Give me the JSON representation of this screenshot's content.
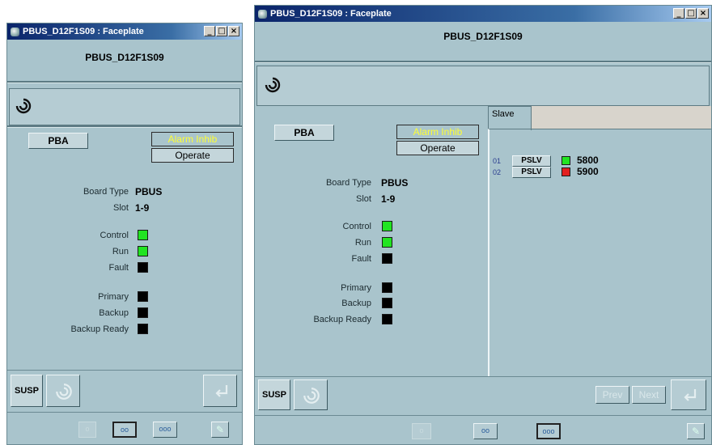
{
  "left": {
    "title": "PBUS_D12F1S09 : Faceplate",
    "header": "PBUS_D12F1S09",
    "pba_label": "PBA",
    "alarm_label": "Alarm Inhib",
    "operate_label": "Operate",
    "board_type_label": "Board Type",
    "board_type_value": "PBUS",
    "slot_label": "Slot",
    "slot_value": "1-9",
    "control_label": "Control",
    "run_label": "Run",
    "fault_label": "Fault",
    "primary_label": "Primary",
    "backup_label": "Backup",
    "backup_ready_label": "Backup Ready",
    "susp_label": "SUSP",
    "page1": "o",
    "page2": "oo",
    "page3": "ooo"
  },
  "right": {
    "title": "PBUS_D12F1S09 : Faceplate",
    "header": "PBUS_D12F1S09",
    "pba_label": "PBA",
    "alarm_label": "Alarm Inhib",
    "operate_label": "Operate",
    "board_type_label": "Board Type",
    "board_type_value": "PBUS",
    "slot_label": "Slot",
    "slot_value": "1-9",
    "control_label": "Control",
    "run_label": "Run",
    "fault_label": "Fault",
    "primary_label": "Primary",
    "backup_label": "Backup",
    "backup_ready_label": "Backup Ready",
    "tab_label": "Slave",
    "slaves": [
      {
        "no": "01",
        "button": "PSLV",
        "status": "green",
        "value": "5800"
      },
      {
        "no": "02",
        "button": "PSLV",
        "status": "red",
        "value": "5900"
      }
    ],
    "susp_label": "SUSP",
    "prev_label": "Prev",
    "next_label": "Next",
    "page1": "o",
    "page2": "oo",
    "page3": "ooo"
  },
  "window_buttons": [
    "_",
    "□",
    "×"
  ],
  "icons": [
    "app-icon",
    "swirl-logo-icon",
    "enter-icon",
    "pin-icon"
  ],
  "colors": {
    "panel_bg": "#a9c4cc",
    "indicator_on": "#22e422",
    "indicator_off": "#000000",
    "indicator_alarm": "#e21f1f",
    "alarm_text": "#ffff33"
  }
}
